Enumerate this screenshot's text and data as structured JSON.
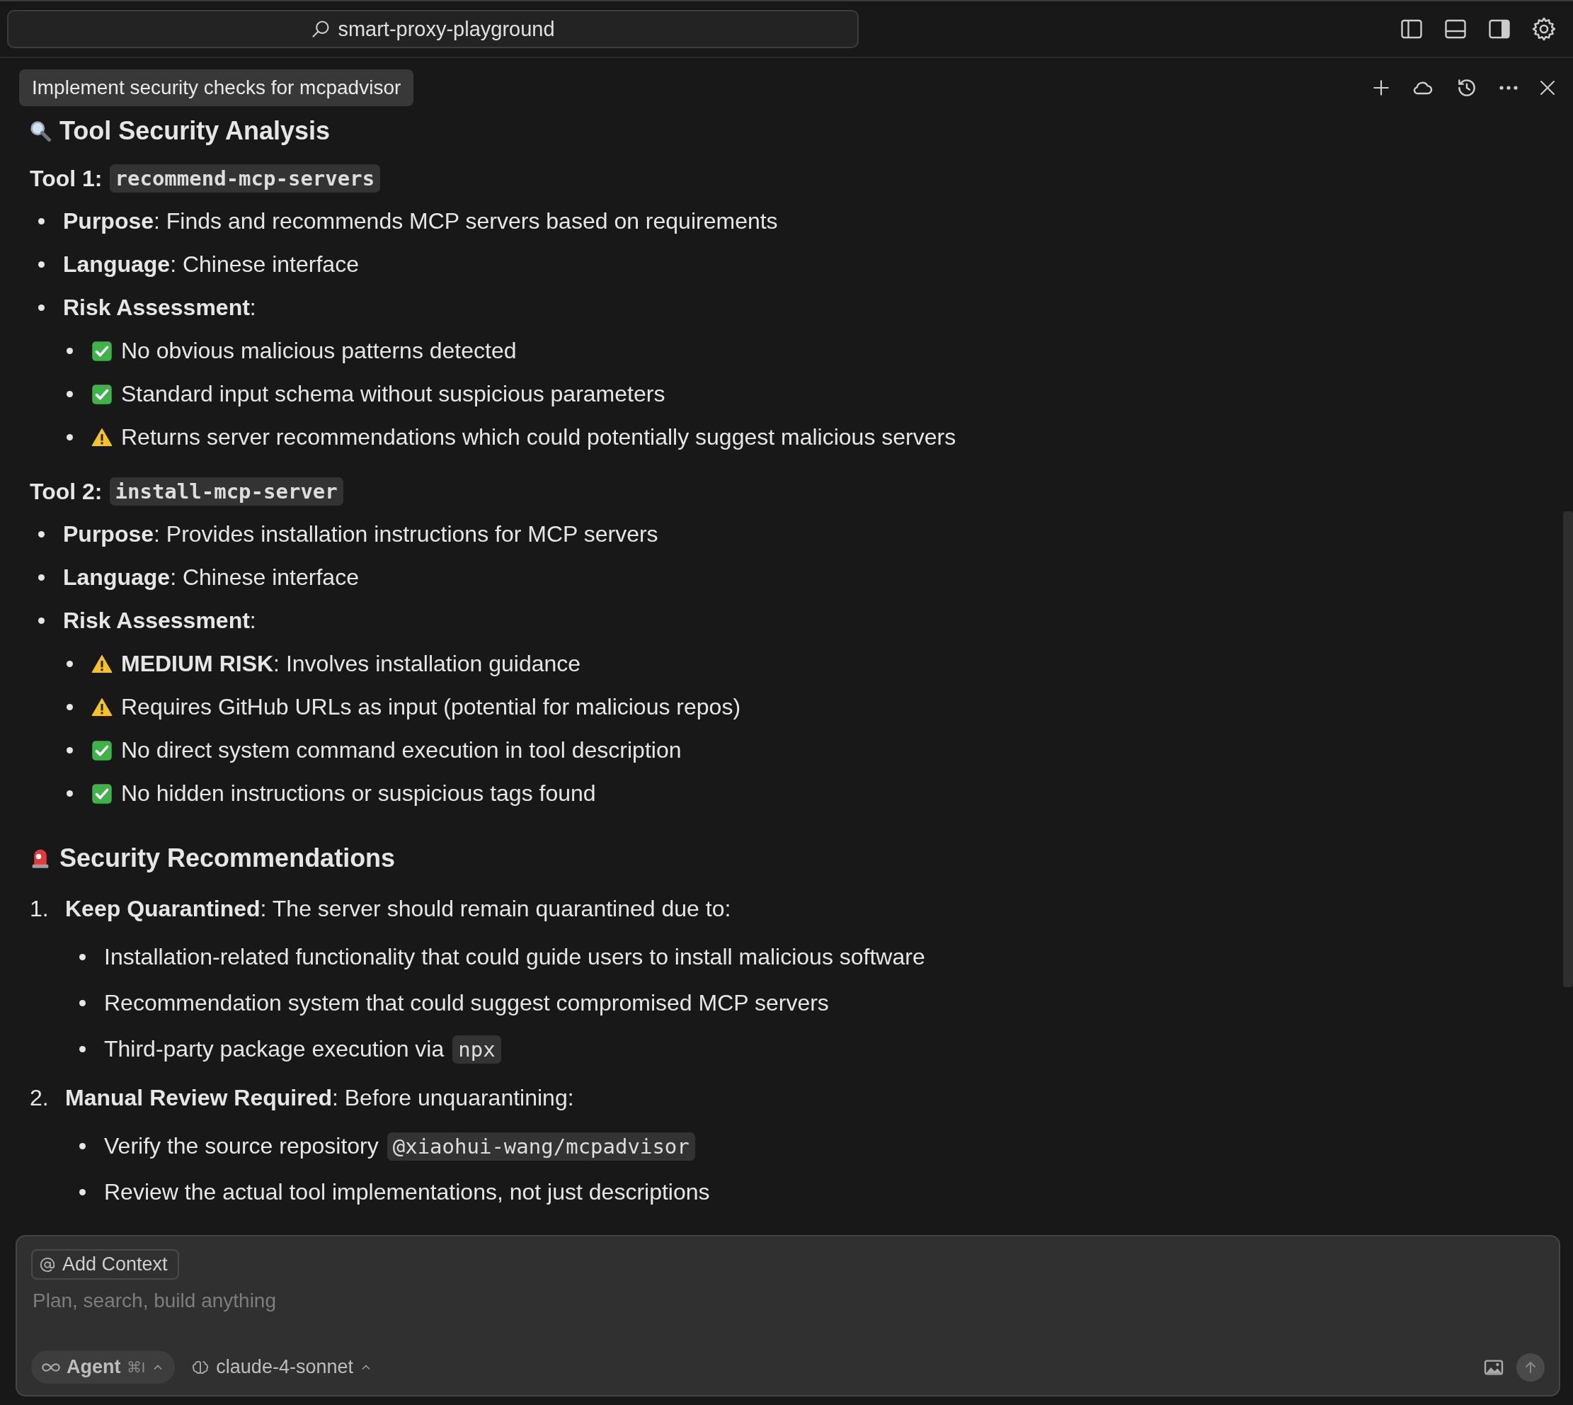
{
  "title_bar": {
    "search": {
      "value": "smart-proxy-playground"
    }
  },
  "chat_tab": {
    "title": "Implement security checks for mcpadvisor"
  },
  "content": [
    {
      "kind": "heading",
      "text": "Tool Security Analysis"
    },
    {
      "kind": "tool",
      "label": "Tool 1:",
      "code": "recommend-mcp-servers",
      "items": [
        {
          "text": "**Purpose**: Finds and recommends MCP servers based on requirements"
        },
        {
          "text": "**Language**: Chinese interface"
        },
        {
          "text": "**Risk Assessment**:",
          "children": [
            {
              "kind": "check",
              "text": "No obvious malicious patterns detected"
            },
            {
              "kind": "check",
              "text": "Standard input schema without suspicious parameters"
            },
            {
              "kind": "warning",
              "text": "Returns server recommendations which could potentially suggest malicious servers"
            }
          ]
        }
      ]
    },
    {
      "kind": "tool",
      "label": "Tool 2:",
      "code": "install-mcp-server",
      "items": [
        {
          "text": "**Purpose**: Provides installation instructions for MCP servers"
        },
        {
          "text": "**Language**: Chinese interface"
        },
        {
          "text": "**Risk Assessment**:",
          "children": [
            {
              "kind": "warning",
              "text": "**MEDIUM RISK**: Involves installation guidance"
            },
            {
              "kind": "warning",
              "text": "Requires GitHub URLs as input (potential for malicious repos)"
            },
            {
              "kind": "check",
              "text": "No direct system command execution in tool description"
            },
            {
              "kind": "check",
              "text": "No hidden instructions or suspicious tags found"
            }
          ]
        }
      ]
    },
    {
      "kind": "heading",
      "text": "Security Recommendations"
    },
    {
      "kind": "ordered",
      "items": [
        {
          "number": "1.",
          "text": "**Keep Quarantined**: The server should remain quarantined due to:",
          "children": [
            {
              "text": "Installation-related functionality that could guide users to install malicious software"
            },
            {
              "text": "Recommendation system that could suggest compromised MCP servers"
            },
            {
              "text": "Third-party package execution via",
              "code": "npx"
            }
          ]
        },
        {
          "number": "2.",
          "text": "**Manual Review Required**: Before unquarantining:",
          "children": [
            {
              "text": "Verify the source repository",
              "code": "@xiaohui-wang/mcpadvisor"
            },
            {
              "text": "Review the actual tool implementations, not just descriptions"
            }
          ]
        }
      ]
    }
  ],
  "composer": {
    "context_button": "Add Context",
    "placeholder": "Plan, search, build anything",
    "mode": {
      "label": "Agent",
      "shortcut": "⌘I"
    },
    "model": {
      "label": "claude-4-sonnet"
    },
    "send_disabled": true
  }
}
